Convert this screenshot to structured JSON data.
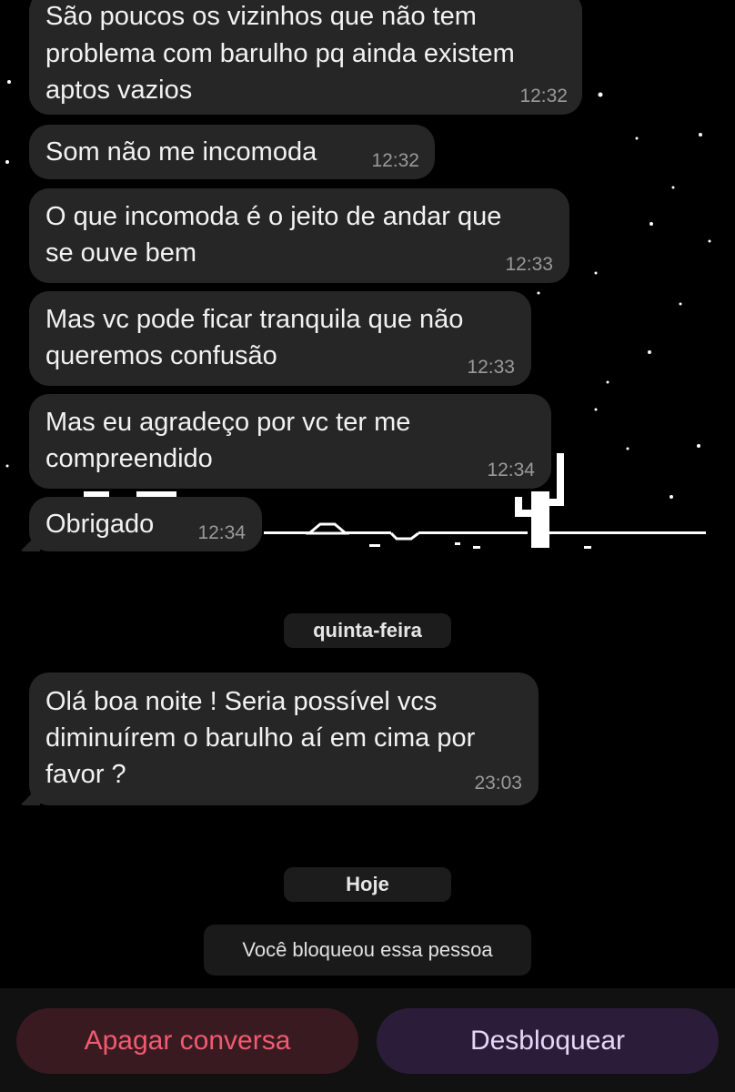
{
  "messages": [
    {
      "lines": [
        "São poucos os vizinhos que não tem",
        "problema com barulho pq ainda existem",
        "aptos vazios"
      ],
      "time": "12:32"
    },
    {
      "lines": [
        "Som não me incomoda"
      ],
      "time": "12:32"
    },
    {
      "lines": [
        "O que incomoda é o jeito de andar que",
        "se ouve bem"
      ],
      "time": "12:33"
    },
    {
      "lines": [
        "Mas vc pode ficar tranquila que não",
        "queremos confusão"
      ],
      "time": "12:33"
    },
    {
      "lines": [
        "Mas eu agradeço por vc ter me",
        "compreendido"
      ],
      "time": "12:34"
    },
    {
      "lines": [
        "Obrigado"
      ],
      "time": "12:34"
    },
    {
      "lines": [
        "Olá boa noite ! Seria possível vcs",
        "diminuírem o barulho aí em cima por",
        "favor ?"
      ],
      "time": "23:03"
    }
  ],
  "date_separators": [
    "quinta-feira",
    "Hoje"
  ],
  "system_notice": "Você bloqueou essa pessoa",
  "actions": {
    "delete_label": "Apagar conversa",
    "unblock_label": "Desbloquear"
  },
  "colors": {
    "background": "#000000",
    "bubble": "#262626",
    "delete_text": "#ef5b6f",
    "unblock_text": "#e8d6f6"
  }
}
